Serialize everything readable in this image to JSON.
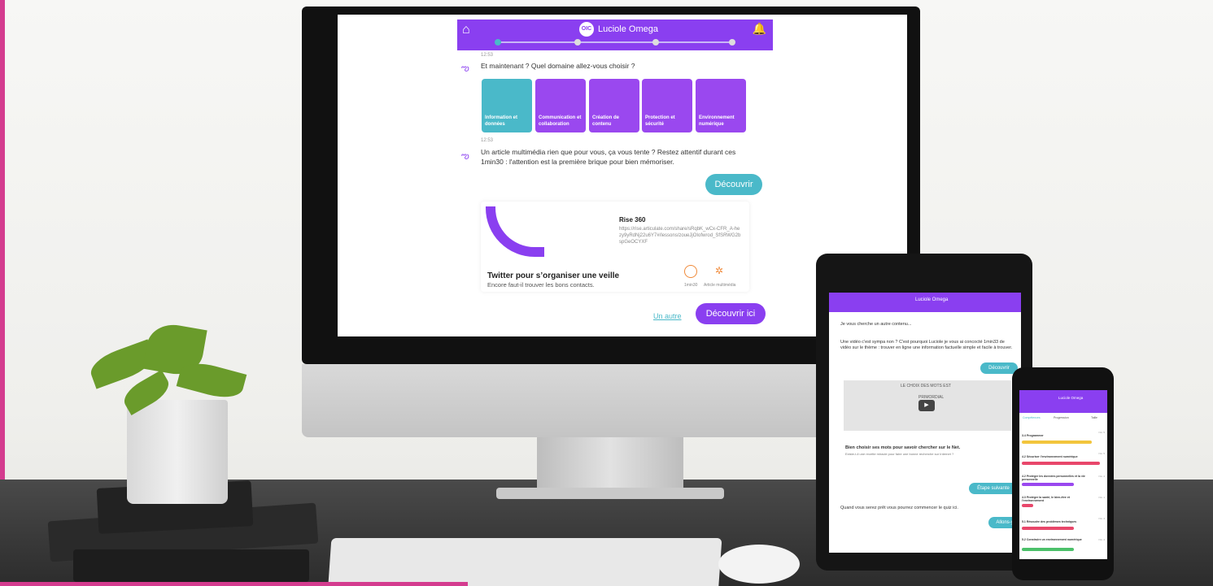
{
  "app": {
    "title": "Luciole Omega",
    "logo_text": "OIC"
  },
  "chat": {
    "time1": "12:53",
    "question": "Et maintenant ? Quel domaine allez-vous choisir ?",
    "domains": [
      {
        "label": "Information et données",
        "color": "#4ab9c9"
      },
      {
        "label": "Communication et collaboration",
        "color": "#9a48ef"
      },
      {
        "label": "Création de contenu",
        "color": "#9a48ef"
      },
      {
        "label": "Protection et sécurité",
        "color": "#9a48ef"
      },
      {
        "label": "Environnement numérique",
        "color": "#9a48ef"
      }
    ],
    "time2": "12:53",
    "suggestion": "Un article multimédia rien que pour vous, ça vous tente ? Restez attentif durant ces 1min30 : l'attention est la première brique pour bien mémoriser.",
    "discover_button": "Découvrir",
    "article": {
      "site": "Rise 360",
      "url": "https://rise.articulate.com/share/sRqbK_wCx-CFR_A-hezy9yRdNj22u6Y7#/lessons/zoueJjOIofwrod_SfSRWG2bspGeOCYXF",
      "title": "Twitter pour s’organiser une veille",
      "subtitle": "Encore faut-il trouver les bons contacts.",
      "duration": "1min30",
      "type": "Article multimédia"
    },
    "other_link": "Un autre",
    "discover_here_button": "Découvrir ici"
  },
  "tablet": {
    "title": "Luciole Omega",
    "msg1": "Je vous cherche un autre contenu...",
    "msg2": "Une vidéo c'est sympa non ? C'est pourquoi Luciole je vous ai concocté 1min33 de vidéo sur le thème : trouver en ligne une information factuelle simple et facile à trouver.",
    "discover_button": "Découvrir",
    "video_line1": "LE CHOIX DES MOTS EST",
    "video_line2": "PRIMORDIAL",
    "card_title": "Bien choisir ses mots pour savoir chercher sur le Net.",
    "card_sub": "Existe-t-il une recette miracle pour faire une bonne recherche sur Internet ?",
    "next_button": "Étape suivante",
    "msg3": "Quand vous serez prêt vous pourrez commencer le quiz ici.",
    "go_button": "Allons-y"
  },
  "phone": {
    "title": "Luciole Omega",
    "tabs": [
      "Compétences",
      "Progression",
      "Taille"
    ],
    "rows": [
      {
        "label": "3.4 Programmer",
        "level": "Niv. 5",
        "pct": "100 %",
        "color": "#f2c53d"
      },
      {
        "label": "4.2 Sécuriser l'environnement numérique",
        "level": "Niv. 5",
        "pct": "100 %",
        "color": "#e8476b"
      },
      {
        "label": "4.2 Protéger les données personnelles et la vie personnelle",
        "level": "Niv. 4",
        "pct": "67 %",
        "color": "#9a48ef"
      },
      {
        "label": "4.3 Protéger la santé, le bien-être et l'environnement",
        "level": "Niv. 1",
        "pct": "13 %",
        "color": "#e8476b"
      },
      {
        "label": "5.1 Résoudre des problèmes techniques",
        "level": "Niv. 4",
        "pct": "67 %",
        "color": "#e8476b"
      },
      {
        "label": "5.2 Construire un environnement numérique",
        "level": "Niv. 4",
        "pct": "67 %",
        "color": "#4cc06a"
      }
    ]
  }
}
